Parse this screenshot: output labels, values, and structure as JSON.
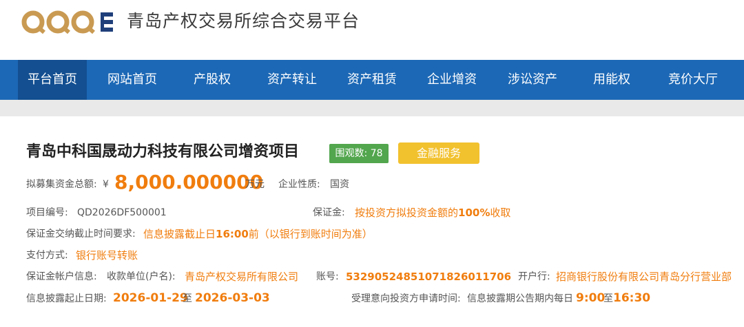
{
  "header": {
    "logo_icon": "qpc-logo-icon",
    "site_title": "青岛产权交易所综合交易平台"
  },
  "nav": {
    "items": [
      {
        "label": "平台首页",
        "active": true
      },
      {
        "label": "网站首页"
      },
      {
        "label": "产股权"
      },
      {
        "label": "资产转让"
      },
      {
        "label": "资产租赁"
      },
      {
        "label": "企业增资"
      },
      {
        "label": "涉讼资产"
      },
      {
        "label": "用能权"
      },
      {
        "label": "竞价大厅"
      }
    ]
  },
  "project": {
    "title": "青岛中科国晟动力科技有限公司增资项目",
    "views": "围观数: 78",
    "finance_button": "金融服务",
    "fund_label": "拟募集资金总额:",
    "currency": "¥",
    "amount": "8,000.000000",
    "unit": "万元",
    "nature_label": "企业性质:",
    "nature_value": "国资",
    "project_no_label": "项目编号:",
    "project_no_value": "QD2026DF500001",
    "deposit_label": "保证金:",
    "deposit_value_prefix": "按投资方拟投资金额的",
    "deposit_value_pct": "100%",
    "deposit_value_suffix": "收取",
    "deadline_label": "保证金交纳截止时间要求:",
    "deadline_prefix": "信息披露截止日",
    "deadline_time": "16:00",
    "deadline_suffix": "前（以银行到账时间为准）",
    "pay_label": "支付方式:",
    "pay_value": "银行账号转账",
    "account_label": "保证金帐户信息:",
    "payee_label": "收款单位(户名):",
    "payee_value": "青岛产权交易所有限公司",
    "acct_no_label": "账号:",
    "acct_no_value": "532905248510718260117​06",
    "bank_label": "开户行:",
    "bank_value": "招商银行股份有限公司青岛分行营业部",
    "date_label": "信息披露起止日期:",
    "date_start": "2026-01-29",
    "date_to": "至",
    "date_end": "2026-03-03",
    "apply_label": "受理意向投资方申请时间:",
    "apply_prefix": "信息披露期公告期内每日",
    "apply_start": "9:00",
    "apply_to": "至",
    "apply_end": "16:30"
  },
  "colors": {
    "nav_bg": "#1c68b6",
    "nav_active": "#134f91",
    "accent_orange": "#f07d0e",
    "badge_green": "#52a64d",
    "button_yellow": "#f2c12e"
  }
}
